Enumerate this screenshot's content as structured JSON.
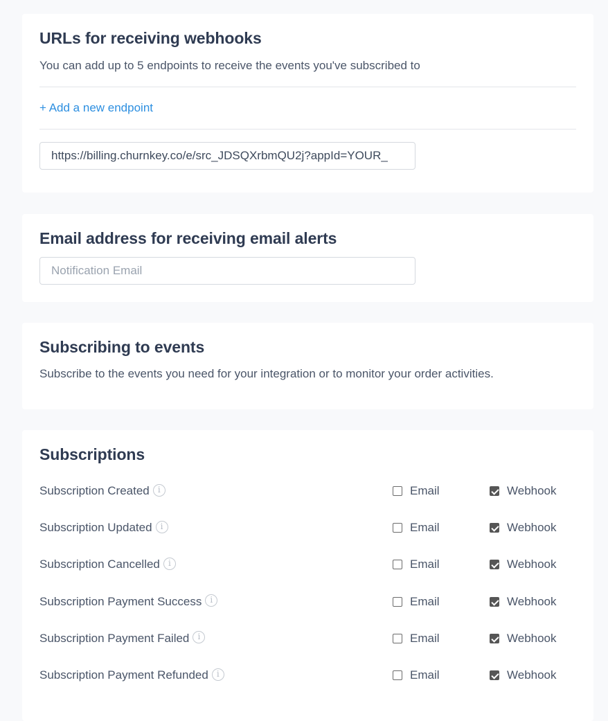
{
  "webhooks": {
    "title": "URLs for receiving webhooks",
    "description": "You can add up to 5 endpoints to receive the events you've subscribed to",
    "add_endpoint_label": "+ Add a new endpoint",
    "endpoint_value": "https://billing.churnkey.co/e/src_JDSQXrbmQU2j?appId=YOUR_"
  },
  "email_alerts": {
    "title": "Email address for receiving email alerts",
    "placeholder": "Notification Email",
    "value": ""
  },
  "events": {
    "title": "Subscribing to events",
    "description": "Subscribe to the events you need for your integration or to monitor your order activities."
  },
  "subscriptions": {
    "title": "Subscriptions",
    "email_label": "Email",
    "webhook_label": "Webhook",
    "info_icon": "info-icon",
    "items": [
      {
        "label": "Subscription Created",
        "email": false,
        "webhook": true
      },
      {
        "label": "Subscription Updated",
        "email": false,
        "webhook": true
      },
      {
        "label": "Subscription Cancelled",
        "email": false,
        "webhook": true
      },
      {
        "label": "Subscription Payment Success",
        "email": false,
        "webhook": true
      },
      {
        "label": "Subscription Payment Failed",
        "email": false,
        "webhook": true
      },
      {
        "label": "Subscription Payment Refunded",
        "email": false,
        "webhook": true
      }
    ]
  }
}
